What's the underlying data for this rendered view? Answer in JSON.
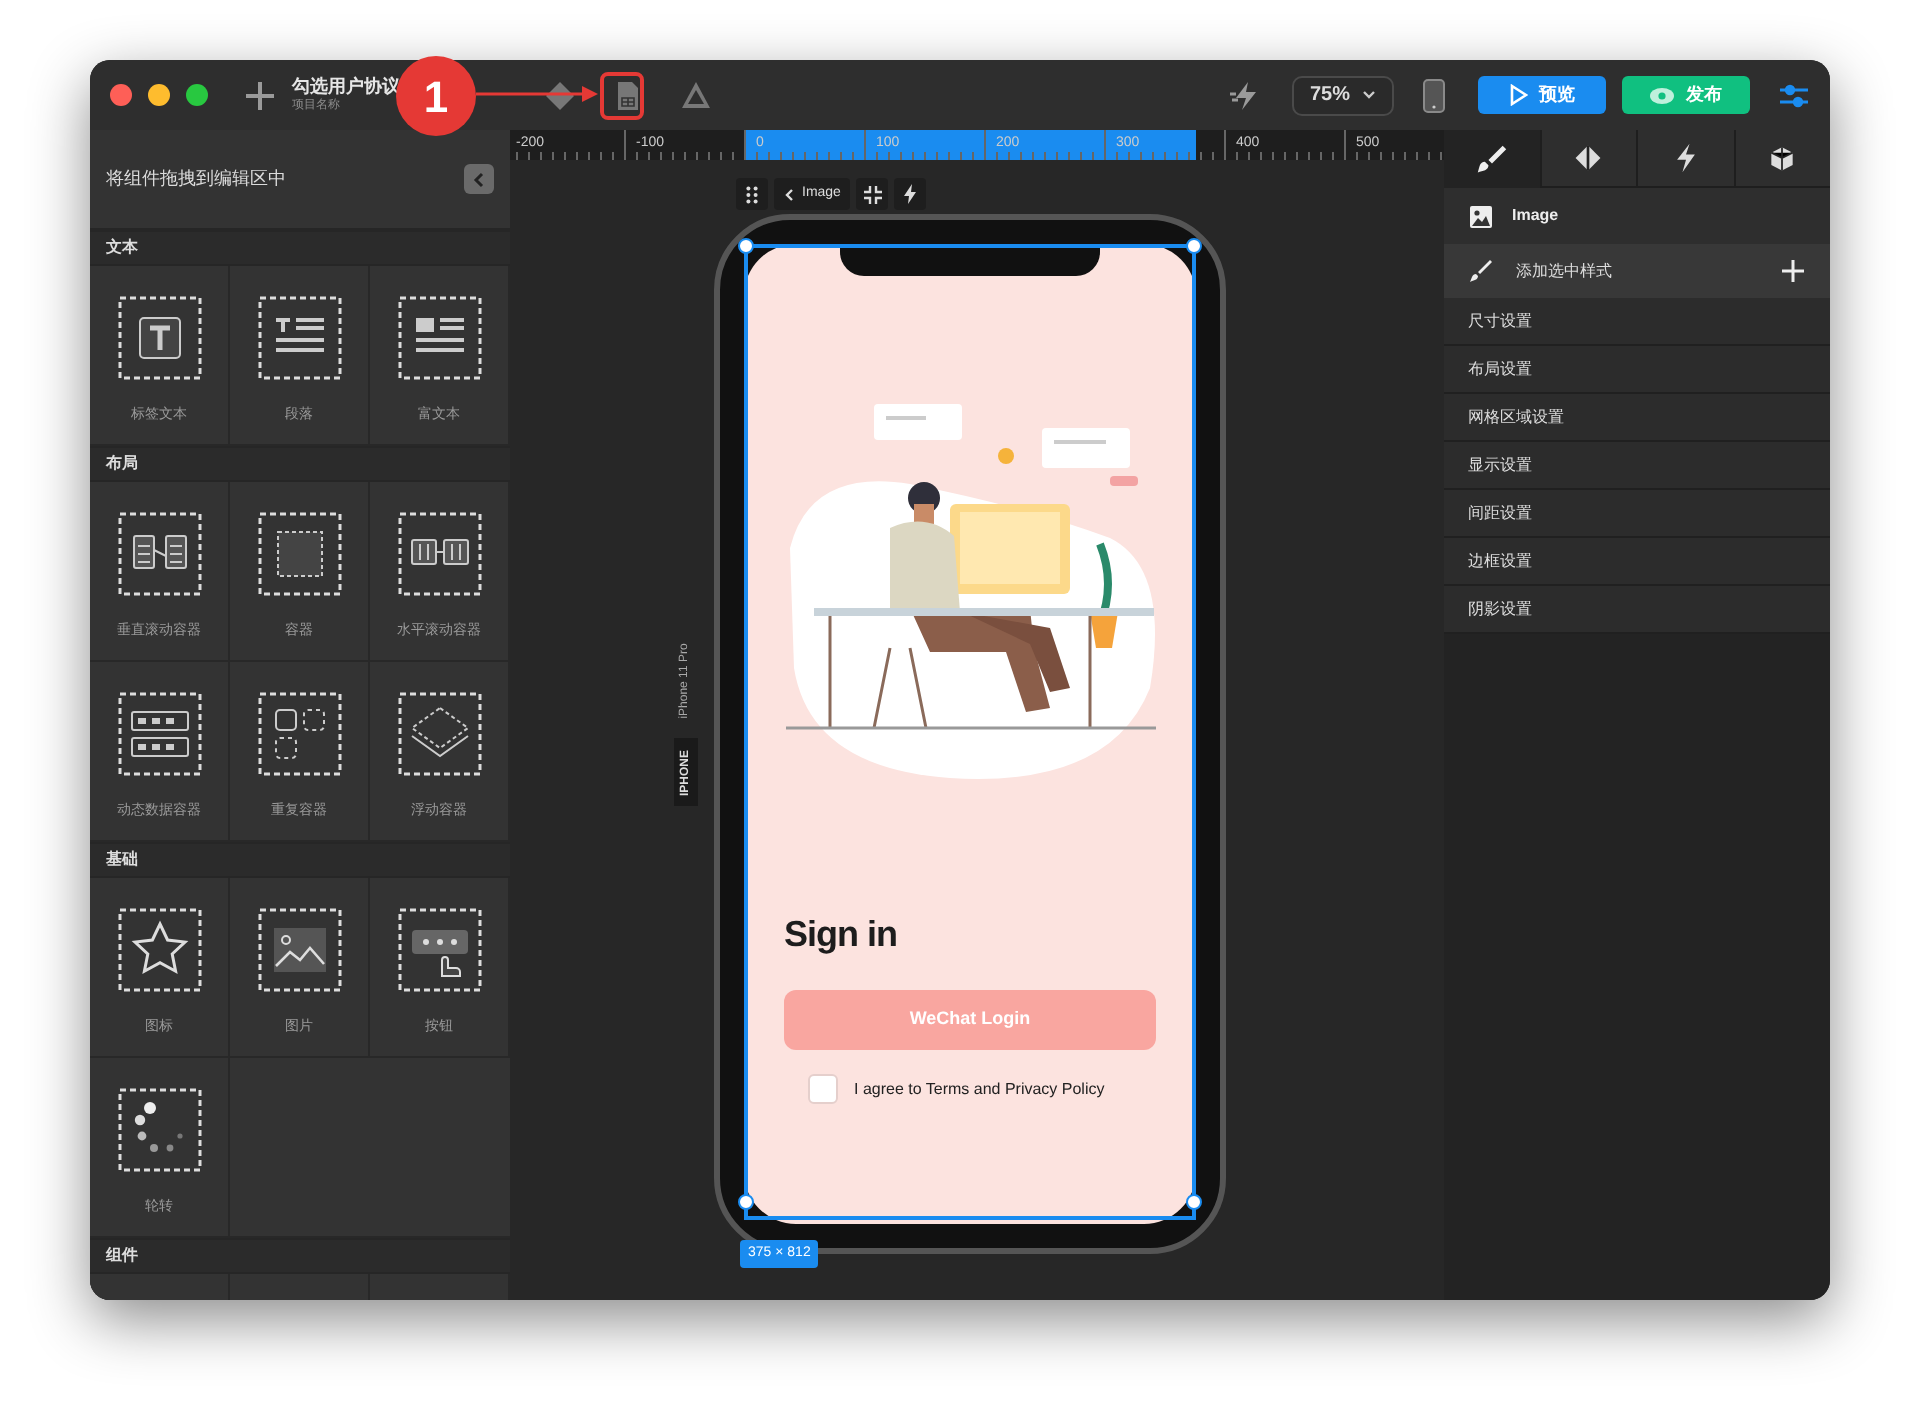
{
  "window": {
    "title": "勾选用户协议",
    "subtitle": "项目名称"
  },
  "toolbar": {
    "tools": [
      {
        "kind": "diamond"
      },
      {
        "kind": "doc-grid"
      },
      {
        "kind": "triangle"
      }
    ],
    "zoom": "75%",
    "preview": "预览",
    "publish": "发布"
  },
  "annotation": {
    "number": "1"
  },
  "components_panel": {
    "title": "将组件拖拽到编辑区中",
    "sections": [
      {
        "title": "文本",
        "items": [
          {
            "label": "标签文本",
            "kind": "label-text"
          },
          {
            "label": "段落",
            "kind": "paragraph"
          },
          {
            "label": "富文本",
            "kind": "rich-text"
          }
        ]
      },
      {
        "title": "布局",
        "items": [
          {
            "label": "垂直滚动容器",
            "kind": "vscroll"
          },
          {
            "label": "容器",
            "kind": "container"
          },
          {
            "label": "水平滚动容器",
            "kind": "hscroll"
          },
          {
            "label": "动态数据容器",
            "kind": "data-list"
          },
          {
            "label": "重复容器",
            "kind": "repeat"
          },
          {
            "label": "浮动容器",
            "kind": "float"
          }
        ]
      },
      {
        "title": "基础",
        "items": [
          {
            "label": "图标",
            "kind": "star"
          },
          {
            "label": "图片",
            "kind": "image"
          },
          {
            "label": "按钮",
            "kind": "button"
          },
          {
            "label": "轮转",
            "kind": "spinner"
          }
        ]
      },
      {
        "title": "组件"
      }
    ]
  },
  "ruler": {
    "ticks": [
      "-200",
      "-100",
      "0",
      "100",
      "200",
      "300",
      "400",
      "500"
    ]
  },
  "canvas": {
    "element_label": "Image",
    "device_name": "iPhone 11 Pro",
    "device_type": "IPHONE",
    "size": "375 × 812"
  },
  "phone": {
    "heading": "Sign in",
    "login_button": "WeChat Login",
    "agree": {
      "checked": false,
      "label": "I agree to Terms and Privacy Policy"
    }
  },
  "inspector": {
    "tabs": [
      {
        "kind": "brush",
        "selected": true
      },
      {
        "kind": "diamond",
        "selected": false
      },
      {
        "kind": "bolt",
        "selected": false
      },
      {
        "kind": "cube",
        "selected": false
      }
    ],
    "element": "Image",
    "add_style": "添加选中样式",
    "sections": [
      "尺寸设置",
      "布局设置",
      "网格区域设置",
      "显示设置",
      "间距设置",
      "边框设置",
      "阴影设置"
    ]
  }
}
